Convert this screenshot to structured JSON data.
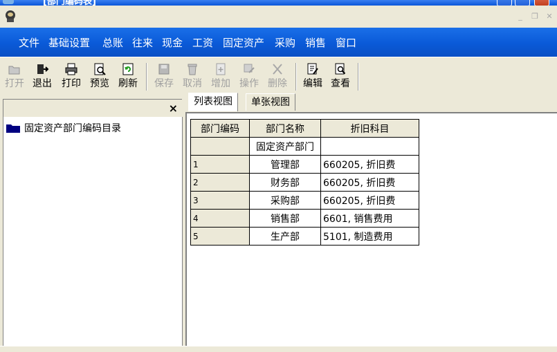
{
  "window": {
    "title": "[部门编码表]"
  },
  "menu": [
    "文件",
    "基础设置",
    "总账",
    "往来",
    "现金",
    "工资",
    "固定资产",
    "采购",
    "销售",
    "窗口"
  ],
  "toolbar": {
    "open": "打开",
    "exit": "退出",
    "print": "打印",
    "preview": "预览",
    "refresh": "刷新",
    "save": "保存",
    "cancel": "取消",
    "add": "增加",
    "operate": "操作",
    "delete": "删除",
    "edit": "编辑",
    "view": "查看"
  },
  "tree": {
    "close": "×",
    "root": "固定资产部门编码目录"
  },
  "tabs": {
    "list_view": "列表视图",
    "single_view": "单张视图"
  },
  "table": {
    "headers": {
      "code": "部门编码",
      "name": "部门名称",
      "account": "折旧科目"
    },
    "rows": [
      {
        "code": "",
        "name": "固定资产部门",
        "account": ""
      },
      {
        "code": "1",
        "name": "管理部",
        "account": "660205, 折旧费"
      },
      {
        "code": "2",
        "name": "财务部",
        "account": "660205, 折旧费"
      },
      {
        "code": "3",
        "name": "采购部",
        "account": "660205, 折旧费"
      },
      {
        "code": "4",
        "name": "销售部",
        "account": "6601, 销售费用"
      },
      {
        "code": "5",
        "name": "生产部",
        "account": "5101, 制造费用"
      }
    ]
  }
}
